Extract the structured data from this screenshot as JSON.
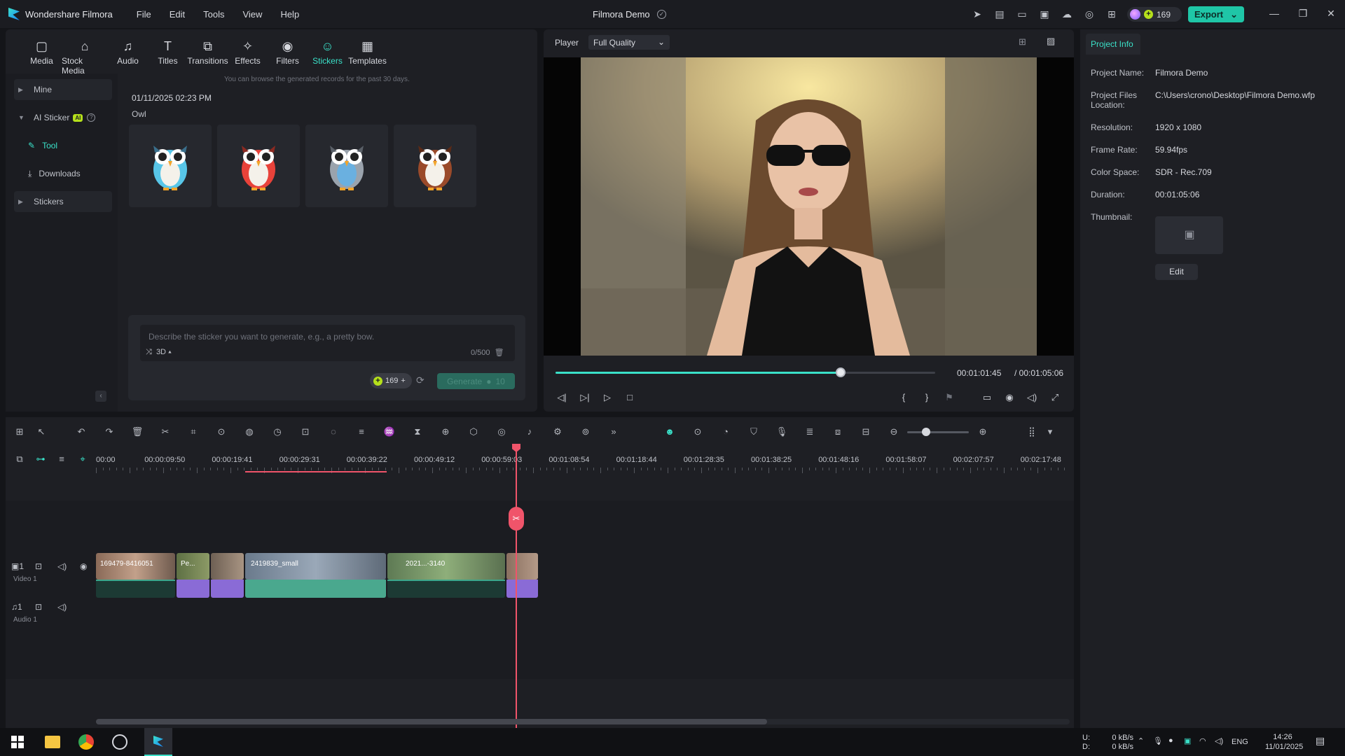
{
  "app": {
    "name": "Wondershare Filmora",
    "project_title": "Filmora Demo",
    "credits": "169",
    "export_label": "Export"
  },
  "menu": [
    "File",
    "Edit",
    "Tools",
    "View",
    "Help"
  ],
  "tabs": [
    {
      "label": "Media",
      "icon": "media-icon"
    },
    {
      "label": "Stock Media",
      "icon": "stock-media-icon"
    },
    {
      "label": "Audio",
      "icon": "audio-icon"
    },
    {
      "label": "Titles",
      "icon": "titles-icon"
    },
    {
      "label": "Transitions",
      "icon": "transitions-icon"
    },
    {
      "label": "Effects",
      "icon": "effects-icon"
    },
    {
      "label": "Filters",
      "icon": "filters-icon"
    },
    {
      "label": "Stickers",
      "icon": "stickers-icon",
      "active": true
    },
    {
      "label": "Templates",
      "icon": "templates-icon"
    }
  ],
  "sidebar": {
    "mine": "Mine",
    "ai_sticker": "AI Sticker",
    "ai_badge": "AI",
    "tool": "Tool",
    "downloads": "Downloads",
    "stickers": "Stickers"
  },
  "stickers_panel": {
    "hint": "You can browse the generated records for the past 30 days.",
    "date": "01/11/2025 02:23 PM",
    "prompt_title": "Owl",
    "owl_colors": [
      "#58c6e8",
      "#e8423a",
      "#6ab0e0",
      "#9a4a2a"
    ],
    "prompt_placeholder": "Describe the sticker you want to generate, e.g., a pretty bow.",
    "style_option": "3D",
    "char_count": "0/500",
    "credit_count": "169",
    "generate_label": "Generate",
    "generate_cost": "10"
  },
  "player": {
    "label": "Player",
    "quality": "Full Quality",
    "current_time": "00:01:01:45",
    "total_time": "/ 00:01:05:06",
    "progress": 0.75
  },
  "project_info": {
    "tab": "Project Info",
    "fields": [
      {
        "label": "Project Name:",
        "value": "Filmora Demo"
      },
      {
        "label": "Project Files Location:",
        "value": "C:\\Users\\crono\\Desktop\\Filmora Demo.wfp"
      },
      {
        "label": "Resolution:",
        "value": "1920 x 1080"
      },
      {
        "label": "Frame Rate:",
        "value": "59.94fps"
      },
      {
        "label": "Color Space:",
        "value": "SDR - Rec.709"
      },
      {
        "label": "Duration:",
        "value": "00:01:05:06"
      }
    ],
    "thumbnail_label": "Thumbnail:",
    "edit_label": "Edit"
  },
  "timeline": {
    "ruler": [
      "00:00",
      "00:00:09:50",
      "00:00:19:41",
      "00:00:29:31",
      "00:00:39:22",
      "00:00:49:12",
      "00:00:59:03",
      "00:01:08:54",
      "00:01:18:44",
      "00:01:28:35",
      "00:01:38:25",
      "00:01:48:16",
      "00:01:58:07",
      "00:02:07:57",
      "00:02:17:48"
    ],
    "video_track": "Video 1",
    "audio_track": "Audio 1",
    "track_number": "1",
    "clips": [
      "169479-8416051",
      "Pe...",
      "",
      "2419839_small",
      "2021...-3140",
      ""
    ]
  },
  "taskbar": {
    "net_up": "0 kB/s",
    "net_down": "0 kB/s",
    "lang": "ENG",
    "time": "14:26",
    "date": "11/01/2025",
    "disk_u": "U:",
    "disk_d": "D:"
  }
}
